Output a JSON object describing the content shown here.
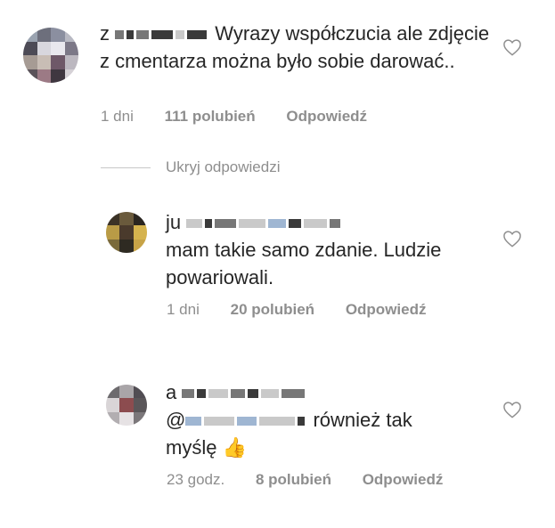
{
  "comments": [
    {
      "username_visible": "z",
      "text": "Wyrazy współczucia ale zdjęcie z cmentarza można było sobie darować..",
      "time": "1 dni",
      "likes": "111 polubień",
      "reply": "Odpowiedź"
    },
    {
      "username_visible": "ju",
      "text": "mam takie samo zdanie. Ludzie powariowali.",
      "time": "1 dni",
      "likes": "20 polubień",
      "reply": "Odpowiedź"
    },
    {
      "username_visible": "a",
      "mention_prefix": "@",
      "text": "również tak myślę",
      "emoji": "👍",
      "time": "23 godz.",
      "likes": "8 polubień",
      "reply": "Odpowiedź"
    }
  ],
  "replies_toggle": "Ukryj odpowiedzi",
  "colors": {
    "text": "#262626",
    "meta": "#8e8e8e",
    "heart_outline": "#8e8e8e"
  },
  "icons": {
    "like": "heart-outline-icon"
  }
}
